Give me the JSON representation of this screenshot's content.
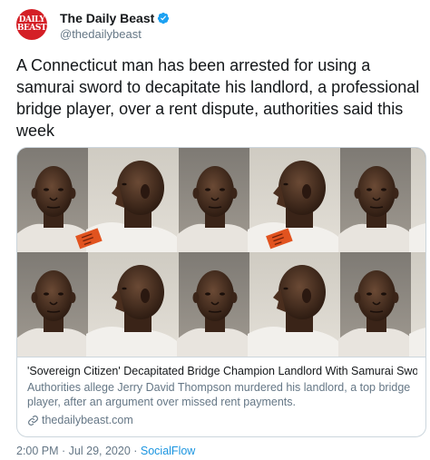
{
  "tweet": {
    "logo_text": [
      "DAILY",
      "BEAST"
    ],
    "display_name": "The Daily Beast",
    "handle": "@thedailybeast",
    "verified_icon": "verified-badge-icon",
    "text": "A Connecticut man has been arrested for using a samurai sword to decapitate his landlord, a professional bridge player, over a rent dispute, authorities said this week",
    "card": {
      "title": "'Sovereign Citizen' Decapitated Bridge Champion Landlord With Samurai Sword: ...",
      "description": "Authorities allege Jerry David Thompson murdered his landlord, a top bridge player, after an argument over missed rent payments.",
      "link_icon": "link-icon",
      "link": "thedailybeast.com"
    },
    "time": "2:00 PM · Jul 29, 2020 · ",
    "source": "SocialFlow"
  },
  "colors": {
    "brand_red": "#d41f26",
    "verified_blue": "#1da1f2",
    "link_blue": "#1b95e0",
    "muted_gray": "#657786"
  }
}
